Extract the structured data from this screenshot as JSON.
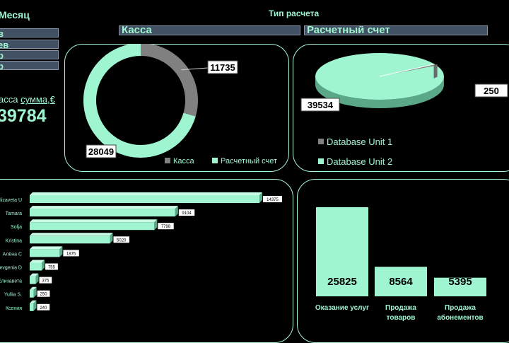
{
  "slicer_month": {
    "title": "Месяц",
    "items": [
      "в",
      "ев",
      "р",
      "р"
    ]
  },
  "summary": {
    "label_prefix": "асса",
    "label_main": "сумма,€",
    "value": "39784"
  },
  "slicer_payment": {
    "title": "Тип расчета",
    "items": [
      "Касса",
      "Расчетный счет"
    ]
  },
  "colors": {
    "accent": "#9ef5d0",
    "gray": "#808080",
    "button_bg": "#425063"
  },
  "chart_data": [
    {
      "type": "pie",
      "variant": "donut",
      "labels": [
        "Касса",
        "Расчетный счет"
      ],
      "values": [
        11735,
        28049
      ],
      "colors": [
        "#808080",
        "#9ef5d0"
      ],
      "legend": "bottom"
    },
    {
      "type": "pie",
      "variant": "3d",
      "labels": [
        "Database Unit 1",
        "Database Unit 2"
      ],
      "values": [
        250,
        39534
      ],
      "colors": [
        "#808080",
        "#9ef5d0"
      ],
      "legend": "bottom"
    },
    {
      "type": "bar",
      "orientation": "horizontal",
      "categories": [
        "lizaveta U",
        "Tamara",
        "Sofja",
        "Kristina",
        "Алёна С",
        "evgenia D",
        "Елизавета",
        "Yuliia S.",
        "Ксения"
      ],
      "values": [
        14375,
        9104,
        7798,
        5020,
        1875,
        755,
        375,
        250,
        240
      ],
      "xlim": [
        0,
        17000
      ]
    },
    {
      "type": "bar",
      "orientation": "vertical",
      "categories": [
        "Оказание услуг",
        "Продажа товаров",
        "Продажа абонементов"
      ],
      "category_lines": [
        [
          "Оказание услуг"
        ],
        [
          "Продажа",
          "товаров"
        ],
        [
          "Продажа",
          "абонементов"
        ]
      ],
      "values": [
        25825,
        8564,
        5395
      ],
      "ylim": [
        0,
        30000
      ]
    }
  ]
}
